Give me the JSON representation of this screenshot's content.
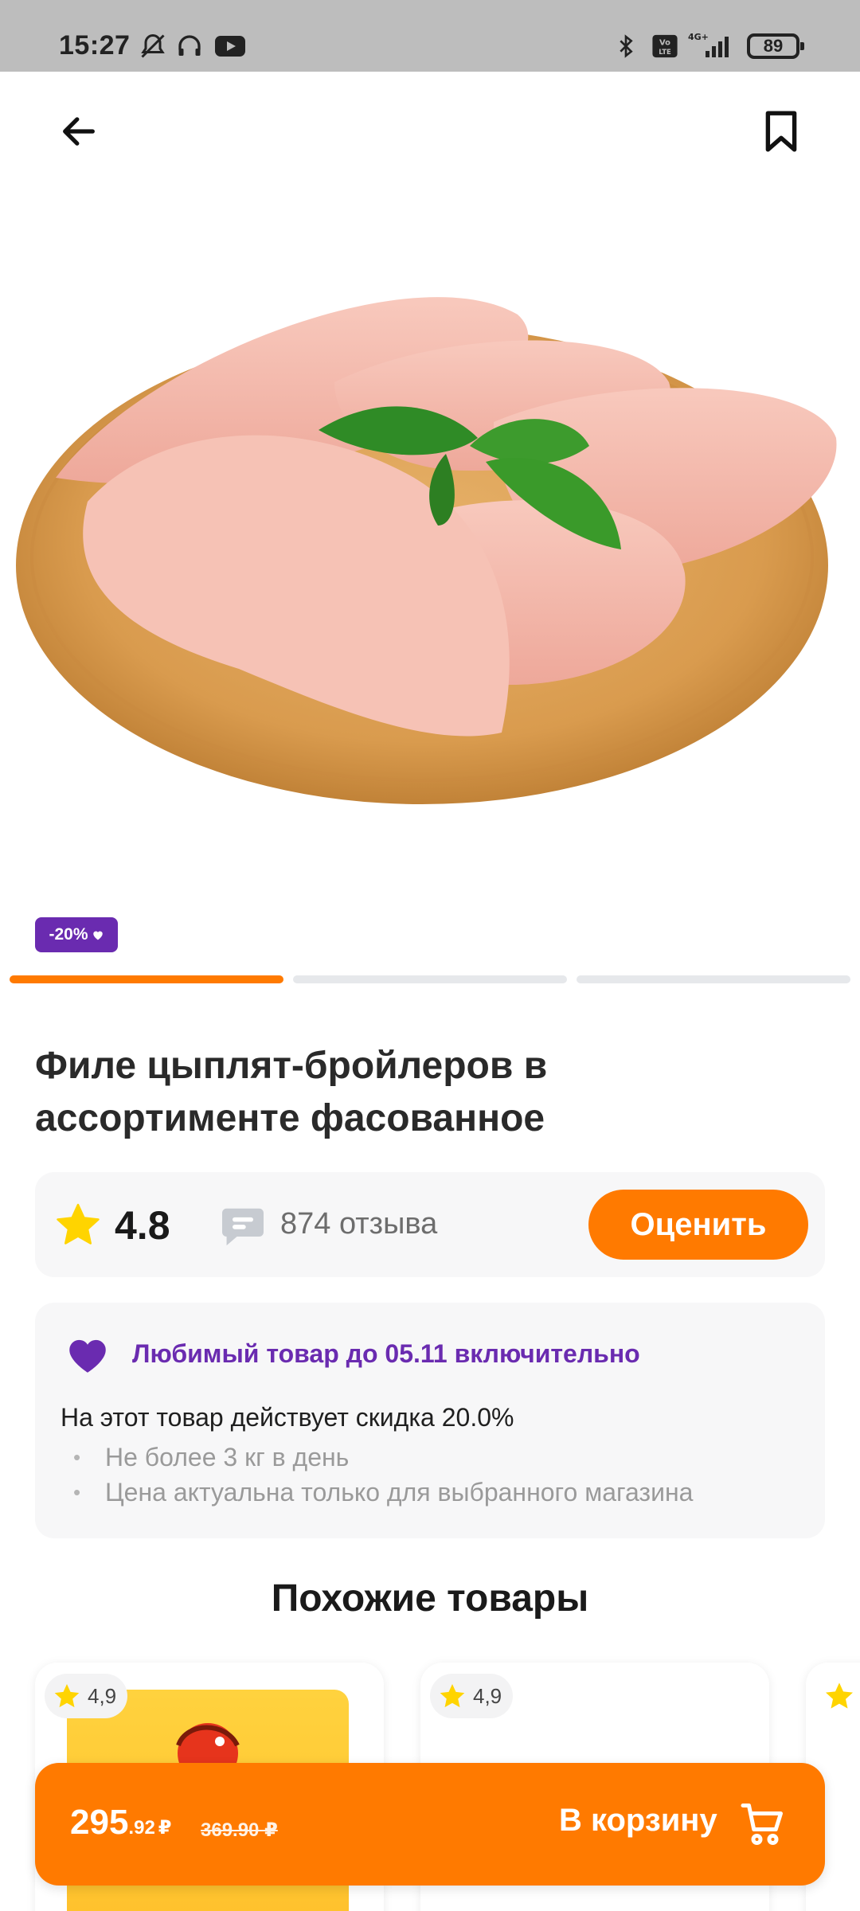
{
  "status_bar": {
    "time": "15:27",
    "battery": "89",
    "network": "4G+"
  },
  "product": {
    "promo_badge": "-20%",
    "title": "Филе цыплят-бройлеров в ассортименте фасованное",
    "rating": "4.8",
    "reviews": "874 отзыва",
    "rate_button": "Оценить",
    "image_slides": 3,
    "active_slide": 1
  },
  "promo": {
    "headline": "Любимый товар до 05.11 включительно",
    "description": "На этот товар действует скидка 20.0%",
    "bullets": [
      "Не более 3 кг в день",
      "Цена актуальна только для выбранного магазина"
    ]
  },
  "similar": {
    "title": "Похожие товары",
    "items": [
      {
        "rating": "4,9"
      },
      {
        "rating": "4,9"
      }
    ]
  },
  "cart": {
    "price_int": "295",
    "price_cents": ".92",
    "currency": "₽",
    "old_price": "369.90 ₽",
    "button_label": "В корзину"
  },
  "colors": {
    "accent": "#ff7a00",
    "purple": "#6a2bb0",
    "star": "#ffd400"
  },
  "icons": [
    "back-arrow-icon",
    "bookmark-icon",
    "star-icon",
    "comment-icon",
    "heart-icon",
    "cart-icon"
  ]
}
